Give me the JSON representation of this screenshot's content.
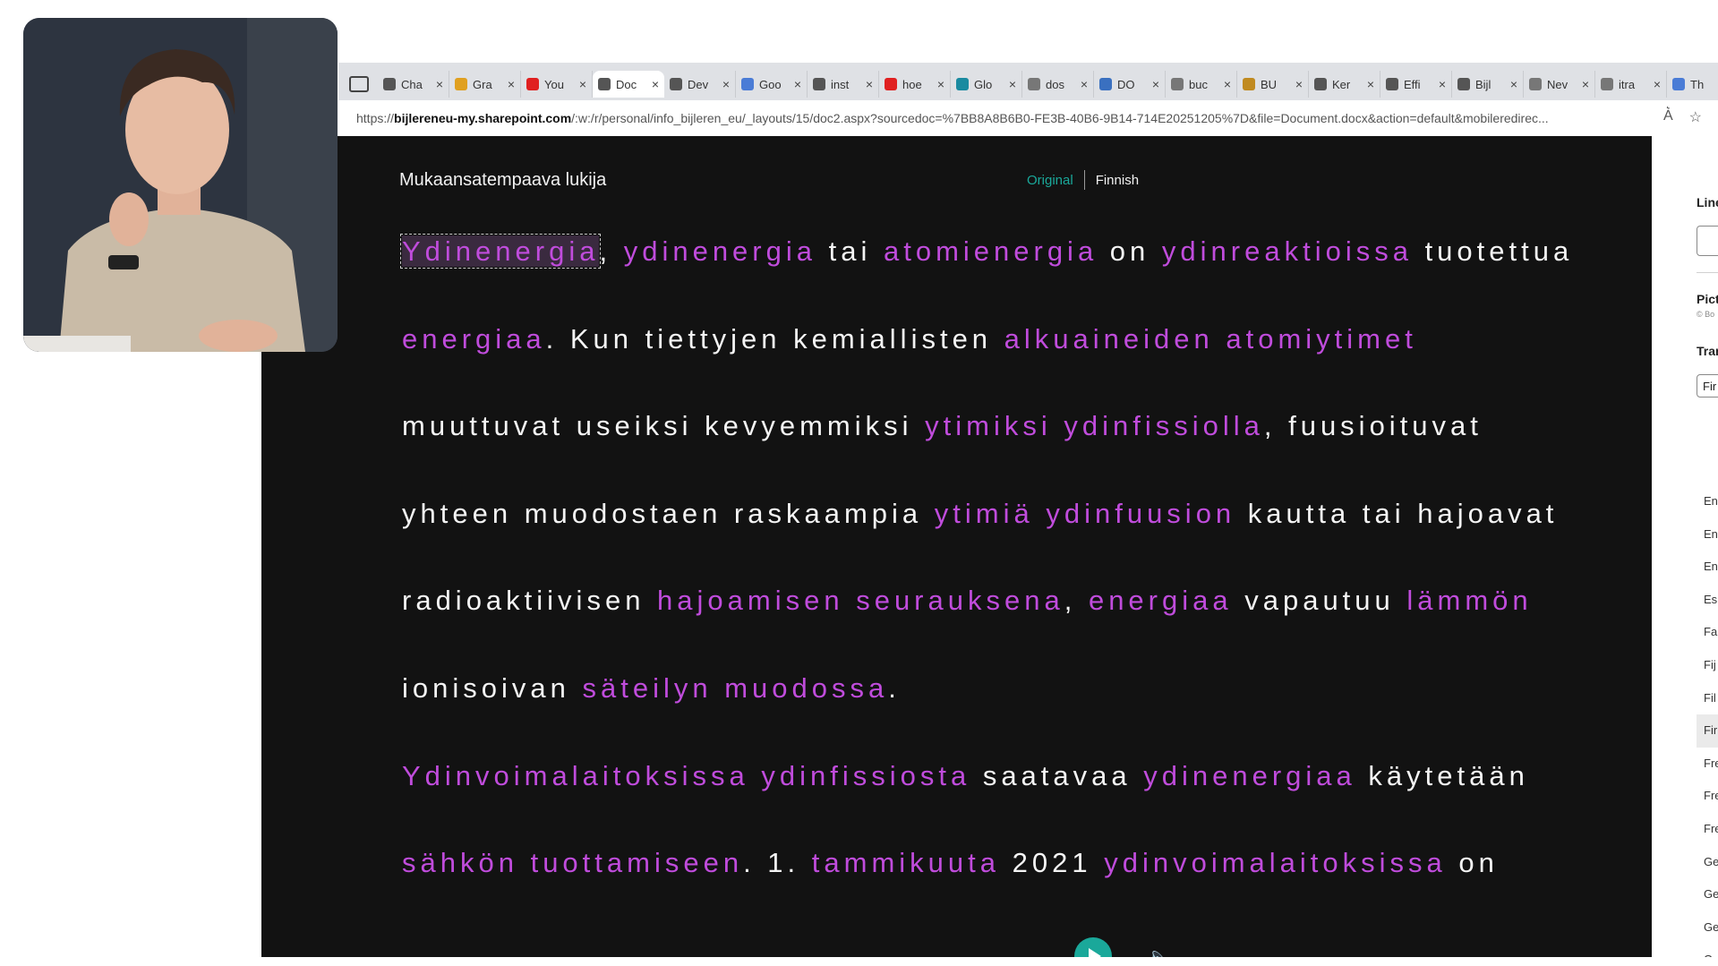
{
  "browser": {
    "tabs": [
      {
        "label": "Cha",
        "fav": "#555555"
      },
      {
        "label": "Gra",
        "fav": "#e0a020"
      },
      {
        "label": "You",
        "fav": "#e02020"
      },
      {
        "label": "Doc",
        "fav": "#555555",
        "active": true
      },
      {
        "label": "Dev",
        "fav": "#555555"
      },
      {
        "label": "Goo",
        "fav": "#4a7cd6"
      },
      {
        "label": "inst",
        "fav": "#555555"
      },
      {
        "label": "hoe",
        "fav": "#e02020"
      },
      {
        "label": "Glo",
        "fav": "#1a8aa0"
      },
      {
        "label": "dos",
        "fav": "#777777"
      },
      {
        "label": "DO",
        "fav": "#3a70c0"
      },
      {
        "label": "buc",
        "fav": "#777777"
      },
      {
        "label": "BU",
        "fav": "#c08a20"
      },
      {
        "label": "Ker",
        "fav": "#555555"
      },
      {
        "label": "Effi",
        "fav": "#555555"
      },
      {
        "label": "Bijl",
        "fav": "#555555"
      },
      {
        "label": "Nev",
        "fav": "#777777"
      },
      {
        "label": "itra",
        "fav": "#777777"
      },
      {
        "label": "Th",
        "fav": "#4a7cd6"
      }
    ],
    "url_scheme": "https://",
    "url_host": "bijlereneu-my.sharepoint.com",
    "url_path": "/:w:/r/personal/info_bijleren_eu/_layouts/15/doc2.aspx?sourcedoc=%7BB8A8B6B0-FE3B-40B6-9B14-714E20251205%7D&file=Document.docx&action=default&mobileredirec..."
  },
  "reader": {
    "title": "Mukaansatempaava lukija",
    "original_label": "Original",
    "language_label": "Finnish",
    "lines": [
      [
        {
          "t": "Ydinenergia",
          "hl": true,
          "focus": true
        },
        {
          "t": ", "
        },
        {
          "t": "ydinenergia",
          "hl": true
        },
        {
          "t": " tai "
        },
        {
          "t": "atomienergia",
          "hl": true
        },
        {
          "t": " on "
        },
        {
          "t": "ydinreaktioissa",
          "hl": true
        },
        {
          "t": " tuotettua"
        }
      ],
      [
        {
          "t": "energiaa",
          "hl": true
        },
        {
          "t": ". Kun tiettyjen kemiallisten "
        },
        {
          "t": "alkuaineiden atomiytimet",
          "hl": true
        }
      ],
      [
        {
          "t": "muuttuvat useiksi kevyemmiksi "
        },
        {
          "t": "ytimiksi ydinfissiolla",
          "hl": true
        },
        {
          "t": ", fuusioituvat"
        }
      ],
      [
        {
          "t": "yhteen muodostaen raskaampia "
        },
        {
          "t": "ytimiä ydinfuusion",
          "hl": true
        },
        {
          "t": " kautta tai hajoavat"
        }
      ],
      [
        {
          "t": "radioaktiivisen "
        },
        {
          "t": "hajoamisen seurauksena",
          "hl": true
        },
        {
          "t": ", "
        },
        {
          "t": "energiaa",
          "hl": true
        },
        {
          "t": " vapautuu "
        },
        {
          "t": "lämmön",
          "hl": true
        }
      ],
      [
        {
          "t": "ionisoivan "
        },
        {
          "t": "säteilyn muodossa",
          "hl": true
        },
        {
          "t": "."
        }
      ],
      [
        {
          "t": "Ydinvoimalaitoksissa ydinfissiosta",
          "hl": true
        },
        {
          "t": " saatavaa "
        },
        {
          "t": "ydinenergiaa",
          "hl": true
        },
        {
          "t": " käytetään"
        }
      ],
      [
        {
          "t": "sähkön tuottamiseen",
          "hl": true
        },
        {
          "t": ". 1. "
        },
        {
          "t": "tammikuuta",
          "hl": true
        },
        {
          "t": " 2021 "
        },
        {
          "t": "ydinvoimalaitoksissa",
          "hl": true
        },
        {
          "t": " on"
        }
      ]
    ]
  },
  "settings": {
    "line_focus_label": "Line",
    "picture_label": "Pict",
    "picture_sub": "© Bo",
    "translate_label": "Tran",
    "dropdown_value": "Fir",
    "languages": [
      "En",
      "En",
      "En",
      "Es",
      "Fa",
      "Fij",
      "Fil",
      "Fir",
      "Fre",
      "Fre",
      "Fre",
      "Ge",
      "Ge",
      "Ge",
      "Ge"
    ],
    "selected_language_index": 7
  }
}
